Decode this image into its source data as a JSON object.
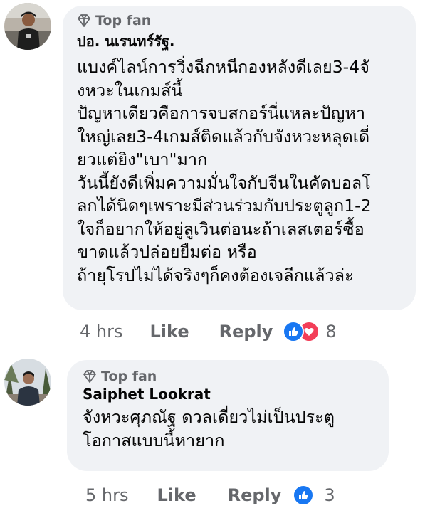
{
  "comments": [
    {
      "badge": "Top fan",
      "author": "ปอ. นเรนทร์รัฐ.",
      "text": "แบงค์ไลน์การวิ่งฉีกหนีกองหลังดีเลย3-4จั\nงหวะในเกมส์นี้\nปัญหาเดียวคือการจบสกอร์นี่แหละปัญหา\nใหญ่เลย3-4เกมส์ติดแล้วกับจังหวะหลุดเดี่\nยวแต่ยิง\"เบา\"มาก\nวันนี้ยังดีเพิ่มความมั่นใจกับจีนในคัดบอลโ\nลกได้นิดๆเพราะมีส่วนร่วมกับประตูลูก1-2\nใจก็อยากให้อยู่ลูเวินต่อนะถ้าเลสเตอร์ซื้อ\nขาดแล้วปล่อยยืมต่อ หรือ\nถ้ายุโรปไม่ได้จริงๆก็คงต้องเจลีกแล้วล่ะ",
      "time": "4 hrs",
      "like": "Like",
      "reply": "Reply",
      "reactions": [
        "like",
        "love"
      ],
      "reaction_count": "8"
    },
    {
      "badge": "Top fan",
      "author": "Saiphet Lookrat",
      "text": "จังหวะศุภณัฐ ดวลเดี่ยวไม่เป็นประตู\nโอกาสแบบนี้หายาก",
      "time": "5 hrs",
      "like": "Like",
      "reply": "Reply",
      "reactions": [
        "like"
      ],
      "reaction_count": "3"
    }
  ],
  "colors": {
    "bubble": "#f0f2f5",
    "meta": "#65676b",
    "like_blue": "#1877f2",
    "love_red": "#f33e58"
  }
}
